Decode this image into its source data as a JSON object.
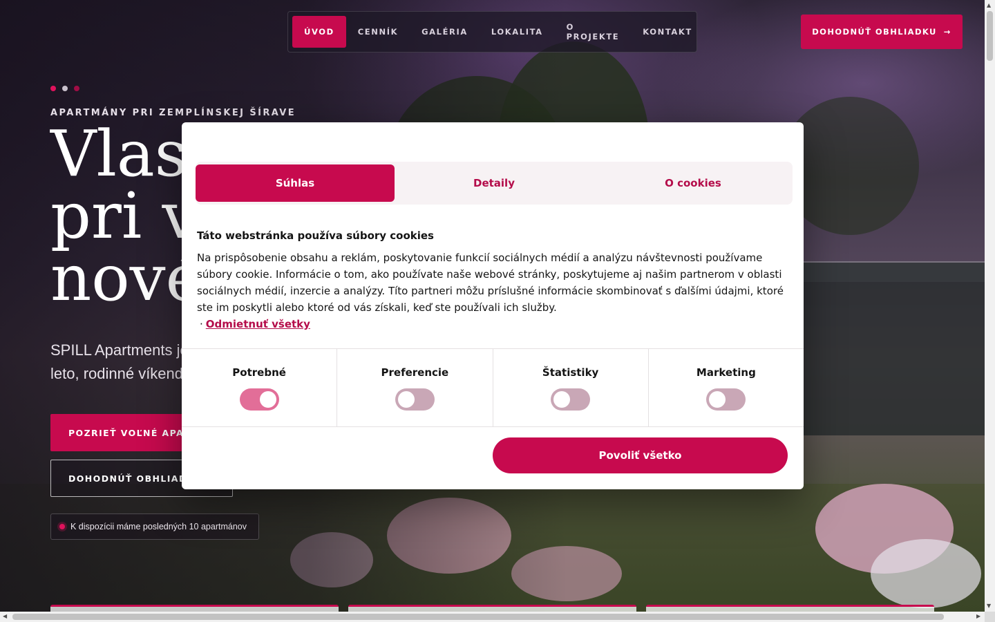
{
  "nav": {
    "items": [
      "ÚVOD",
      "CENNÍK",
      "GALÉRIA",
      "LOKALITA",
      "O PROJEKTE",
      "KONTAKT"
    ],
    "active_index": 0,
    "cta_label": "DOHODNÚŤ OBHLIADKU",
    "cta_icon": "arrow-right-icon",
    "cta_arrow": "→"
  },
  "hero": {
    "eyebrow": "APARTMÁNY PRI ZEMPLÍNSKEJ ŠÍRAVE",
    "headline_lines": [
      "Vlas",
      "pri v",
      "nové"
    ],
    "lede_lines": [
      "SPILL Apartments je",
      "leto, rodinné víkendy"
    ],
    "primary_button": "POZRIEŤ VOĽNÉ APAR",
    "secondary_button": "DOHODNÚŤ OBHLIAD",
    "notice": "K dispozícii máme posledných 10 apartmánov",
    "slide_count": 3,
    "active_slide": 0
  },
  "cookie_dialog": {
    "tabs": [
      "Súhlas",
      "Detaily",
      "O cookies"
    ],
    "active_tab": 0,
    "title": "Táto webstránka používa súbory cookies",
    "body": "Na prispôsobenie obsahu a reklám, poskytovanie funkcií sociálnych médií a analýzu návštevnosti používame súbory cookie. Informácie o tom, ako používate naše webové stránky, poskytujeme aj našim partnerom v oblasti sociálnych médií, inzercie a analýzy. Títo partneri môžu príslušné informácie skombinovať s ďalšími údajmi, ktoré ste im poskytli alebo ktoré od vás získali, keď ste používali ich služby.",
    "separator": "·",
    "decline_link": "Odmietnuť všetky",
    "categories": [
      {
        "label": "Potrebné",
        "enabled": true
      },
      {
        "label": "Preferencie",
        "enabled": false
      },
      {
        "label": "Štatistiky",
        "enabled": false
      },
      {
        "label": "Marketing",
        "enabled": false
      }
    ],
    "allow_all": "Povoliť všetko"
  },
  "colors": {
    "accent": "#c70a4e",
    "toggle_on": "#e26e98",
    "toggle_off": "#c9a7b6",
    "dot_active": "#e0125c",
    "dot_inactive": "#c9c1cc"
  }
}
